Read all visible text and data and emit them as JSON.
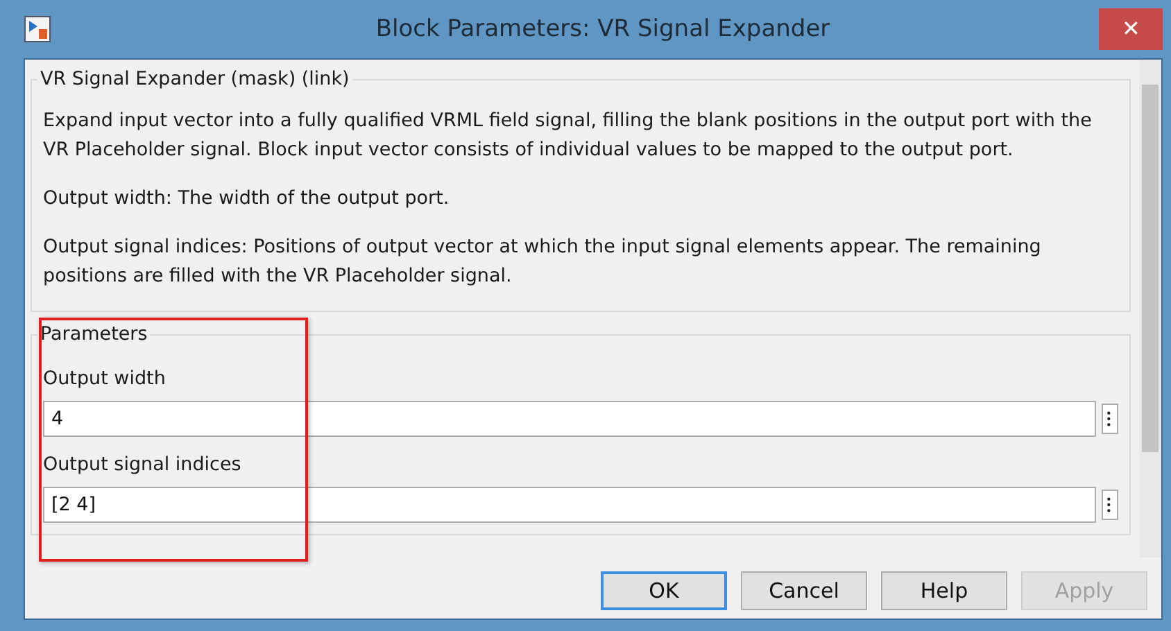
{
  "window": {
    "title": "Block Parameters: VR Signal Expander",
    "close": "✕"
  },
  "description": {
    "title": "VR Signal Expander (mask) (link)",
    "paragraphs": [
      "Expand input vector into a fully qualified VRML field signal, filling the blank positions in the output port with the VR Placeholder signal. Block input vector consists of individual values to be mapped to the output port.",
      "Output width: The width of the output port.",
      "Output signal indices: Positions of output vector at which the input signal elements appear. The remaining positions are filled with the VR Placeholder signal."
    ]
  },
  "parameters": {
    "title": "Parameters",
    "fields": [
      {
        "label": "Output width",
        "value": "4"
      },
      {
        "label": "Output signal indices",
        "value": "[2 4]"
      }
    ]
  },
  "buttons": [
    {
      "label": "OK",
      "default": true,
      "disabled": false
    },
    {
      "label": "Cancel",
      "default": false,
      "disabled": false
    },
    {
      "label": "Help",
      "default": false,
      "disabled": false
    },
    {
      "label": "Apply",
      "default": false,
      "disabled": true
    }
  ]
}
